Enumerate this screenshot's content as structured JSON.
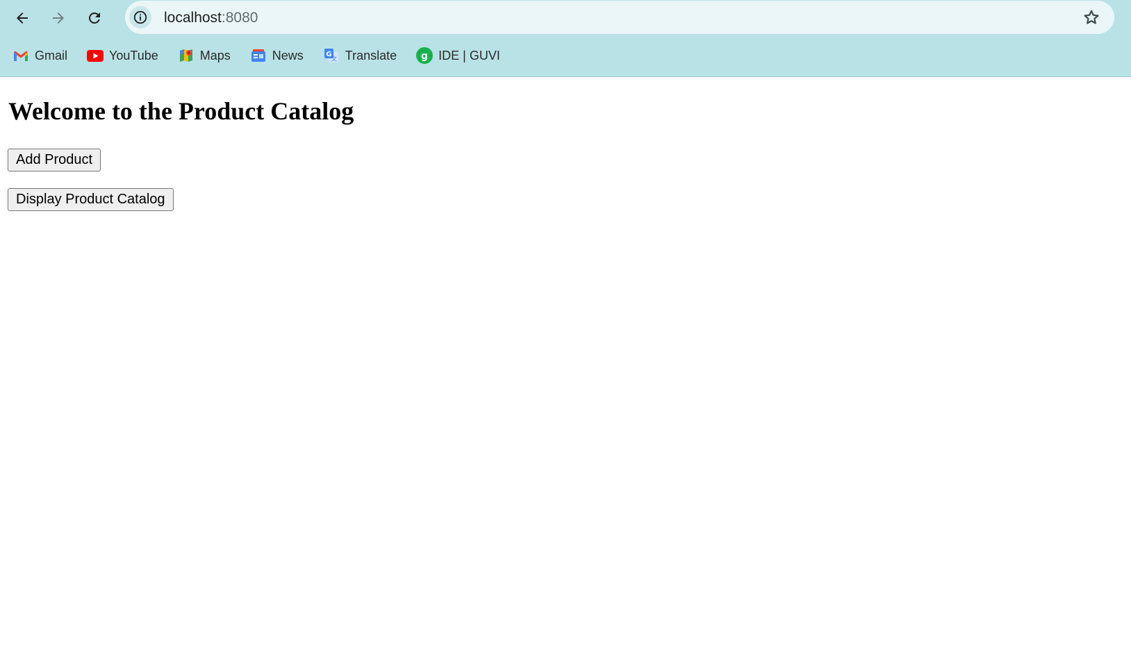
{
  "browser": {
    "url_host": "localhost",
    "url_port": ":8080",
    "bookmarks": [
      {
        "label": "Gmail",
        "icon": "gmail-icon"
      },
      {
        "label": "YouTube",
        "icon": "youtube-icon"
      },
      {
        "label": "Maps",
        "icon": "maps-icon"
      },
      {
        "label": "News",
        "icon": "news-icon"
      },
      {
        "label": "Translate",
        "icon": "translate-icon"
      },
      {
        "label": "IDE | GUVI",
        "icon": "guvi-icon"
      }
    ],
    "colors": {
      "toolbar_bg": "#b9e2e6",
      "omnibox_bg": "#eaf6f7"
    }
  },
  "page": {
    "title": "Welcome to the Product Catalog",
    "add_product_label": "Add Product",
    "display_catalog_label": "Display Product Catalog"
  }
}
